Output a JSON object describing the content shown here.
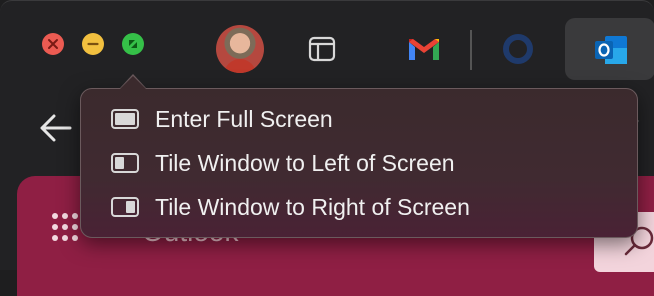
{
  "window_controls": {
    "close_icon": "close-icon",
    "minimize_icon": "minimize-icon",
    "zoom_icon": "zoom-icon",
    "colors": {
      "close": "#ec5b52",
      "minimize": "#f2c03f",
      "zoom": "#35c048"
    }
  },
  "tabs": [
    {
      "name": "profile-avatar"
    },
    {
      "name": "sidebar-icon"
    },
    {
      "name": "gmail-icon"
    },
    {
      "name": "circle-app-icon"
    },
    {
      "name": "outlook-icon"
    }
  ],
  "toolbar": {
    "url_fragment": "/r"
  },
  "app": {
    "title": "Outlook",
    "accent": "#8f1f44"
  },
  "zoom_menu": {
    "items": [
      {
        "label": "Enter Full Screen",
        "icon": "full-screen-icon"
      },
      {
        "label": "Tile Window to Left of Screen",
        "icon": "tile-left-icon"
      },
      {
        "label": "Tile Window to Right of Screen",
        "icon": "tile-right-icon"
      }
    ]
  }
}
